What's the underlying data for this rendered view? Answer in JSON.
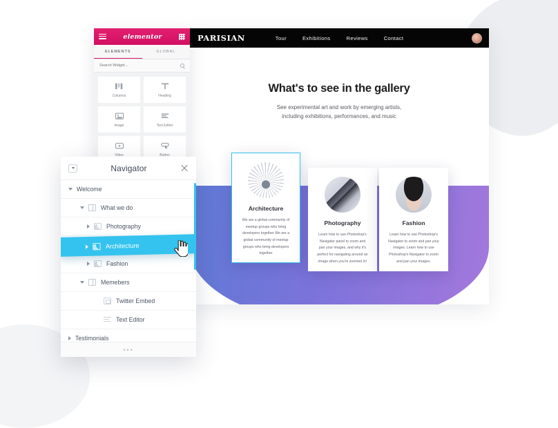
{
  "background": {
    "blob_color": "#eceef1",
    "accent_purple_from": "#5f7ad6",
    "accent_purple_to": "#a578dd"
  },
  "elementor_panel": {
    "logo": "elementor",
    "menu_icon": "hamburger-icon",
    "grid_icon": "grid-icon",
    "tabs": [
      {
        "label": "ELEMENTS",
        "active": true
      },
      {
        "label": "GLOBAL",
        "active": false
      }
    ],
    "search": {
      "placeholder": "Search Widget...",
      "value": "",
      "icon": "search-icon"
    },
    "widgets": [
      {
        "label": "Columns",
        "icon": "columns-icon"
      },
      {
        "label": "Heading",
        "icon": "heading-icon"
      },
      {
        "label": "Image",
        "icon": "image-icon"
      },
      {
        "label": "Text Editor",
        "icon": "text-editor-icon"
      },
      {
        "label": "Video",
        "icon": "video-icon"
      },
      {
        "label": "Button",
        "icon": "button-icon"
      }
    ]
  },
  "site": {
    "logo": "PARISIAN",
    "nav": [
      {
        "label": "Tour"
      },
      {
        "label": "Exhibitions"
      },
      {
        "label": "Reviews"
      },
      {
        "label": "Contact"
      }
    ],
    "avatar": "user-avatar",
    "hero": {
      "title": "What's to see in the gallery",
      "subtitle_line1": "See experimental art and work by emerging artists,",
      "subtitle_line2": "including exhibitions, performances, and music"
    },
    "cards": [
      {
        "title": "Architecture",
        "body": "We are a global community of meetup groups who bring developers together We are a global community of meetup groups who bring developers together",
        "selected": true,
        "selection_color": "#34bef0",
        "thumb": "architecture-dome-photo"
      },
      {
        "title": "Photography",
        "body": "Learn how to use Photoshop's Navigator panel to zoom and pan your images, and why it's perfect for navigating around an image when you're zoomed in!",
        "selected": false,
        "thumb": "camera-lens-photo"
      },
      {
        "title": "Fashion",
        "body": "Learn how to use Photoshop's Navigator  to zoom and pan your images. Learn how to use Photoshop's Navigator  to zoom and pan your images.",
        "selected": false,
        "thumb": "fashion-portrait-photo"
      }
    ]
  },
  "navigator": {
    "title": "Navigator",
    "collapse_icon": "caret-down-box-icon",
    "close_icon": "close-icon",
    "highlight_color": "#34c3ee",
    "resize_grip": "•••",
    "tree": [
      {
        "label": "Welcome",
        "level": 0,
        "arrow": "down",
        "icon": "none",
        "selected": false
      },
      {
        "label": "What we do",
        "level": 1,
        "arrow": "down",
        "icon": "columns",
        "selected": false
      },
      {
        "label": "Photography",
        "level": 2,
        "arrow": "right",
        "icon": "image",
        "selected": false
      },
      {
        "label": "Architecture",
        "level": 2,
        "arrow": "right",
        "icon": "image",
        "selected": true
      },
      {
        "label": "Fashion",
        "level": 2,
        "arrow": "right",
        "icon": "image",
        "selected": false
      },
      {
        "label": "Memebers",
        "level": 1,
        "arrow": "down",
        "icon": "columns",
        "selected": false
      },
      {
        "label": "Twitter Embed",
        "level": 3,
        "arrow": "none",
        "icon": "twitter",
        "selected": false
      },
      {
        "label": "Text Editor",
        "level": 3,
        "arrow": "none",
        "icon": "text",
        "selected": false
      },
      {
        "label": "Testimonials",
        "level": 0,
        "arrow": "right",
        "icon": "none",
        "selected": false
      }
    ]
  },
  "cursor": {
    "type": "grabbing-hand-cursor"
  }
}
